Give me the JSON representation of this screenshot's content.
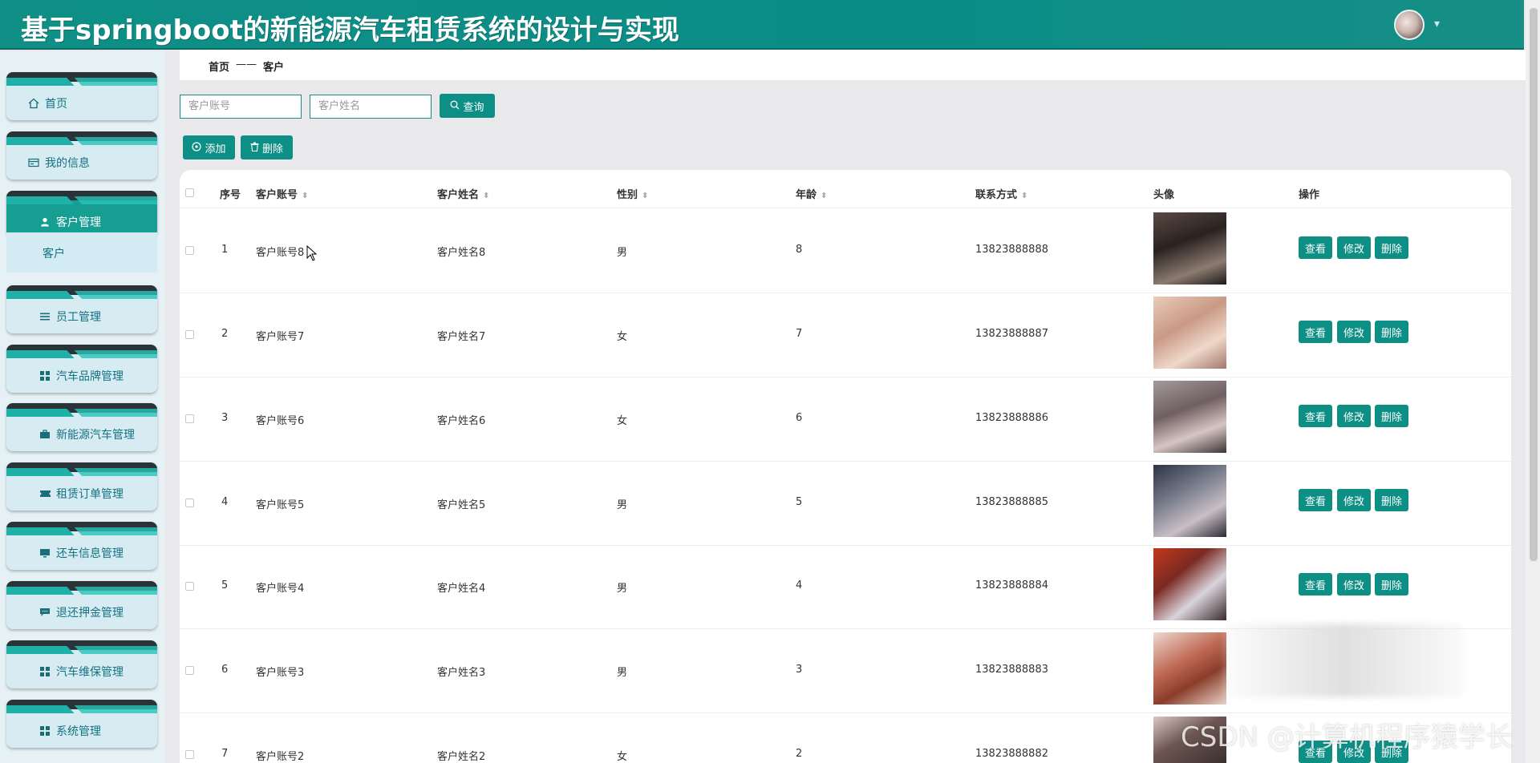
{
  "header": {
    "title": "基于springboot的新能源汽车租赁系统的设计与实现",
    "caret": "▾"
  },
  "sidebar": {
    "items": [
      {
        "label": "首页",
        "icon": "home-icon"
      },
      {
        "label": "我的信息",
        "icon": "id-card-icon"
      },
      {
        "label": "客户管理",
        "icon": "user-icon",
        "active": true
      },
      {
        "label": "员工管理",
        "icon": "list-icon"
      },
      {
        "label": "汽车品牌管理",
        "icon": "grid-icon"
      },
      {
        "label": "新能源汽车管理",
        "icon": "briefcase-icon"
      },
      {
        "label": "租赁订单管理",
        "icon": "ticket-icon"
      },
      {
        "label": "还车信息管理",
        "icon": "monitor-icon"
      },
      {
        "label": "退还押金管理",
        "icon": "chat-icon"
      },
      {
        "label": "汽车维保管理",
        "icon": "grid-icon"
      },
      {
        "label": "系统管理",
        "icon": "grid-icon"
      }
    ],
    "submenu": {
      "label": "客户"
    }
  },
  "breadcrumb": {
    "home": "首页",
    "sep": "——",
    "current": "客户"
  },
  "search": {
    "account_placeholder": "客户账号",
    "name_placeholder": "客户姓名",
    "query_label": "查询"
  },
  "toolbar": {
    "add_label": "添加",
    "delete_label": "删除"
  },
  "table": {
    "columns": [
      "序号",
      "客户账号",
      "客户姓名",
      "性别",
      "年龄",
      "联系方式",
      "头像",
      "操作"
    ],
    "actions": {
      "view": "查看",
      "edit": "修改",
      "delete": "删除"
    },
    "rows": [
      {
        "no": "1",
        "account": "客户账号8",
        "name": "客户姓名8",
        "gender": "男",
        "age": "8",
        "phone": "13823888888"
      },
      {
        "no": "2",
        "account": "客户账号7",
        "name": "客户姓名7",
        "gender": "女",
        "age": "7",
        "phone": "13823888887"
      },
      {
        "no": "3",
        "account": "客户账号6",
        "name": "客户姓名6",
        "gender": "女",
        "age": "6",
        "phone": "13823888886"
      },
      {
        "no": "4",
        "account": "客户账号5",
        "name": "客户姓名5",
        "gender": "男",
        "age": "5",
        "phone": "13823888885"
      },
      {
        "no": "5",
        "account": "客户账号4",
        "name": "客户姓名4",
        "gender": "男",
        "age": "4",
        "phone": "13823888884"
      },
      {
        "no": "6",
        "account": "客户账号3",
        "name": "客户姓名3",
        "gender": "男",
        "age": "3",
        "phone": "13823888883"
      },
      {
        "no": "7",
        "account": "客户账号2",
        "name": "客户姓名2",
        "gender": "女",
        "age": "2",
        "phone": "13823888882"
      }
    ]
  },
  "watermark": "CSDN @计算机程序猿学长",
  "colors": {
    "primary": "#0d8f86",
    "sidebar_bg": "#e6f1f6",
    "active_item": "#179e92"
  }
}
